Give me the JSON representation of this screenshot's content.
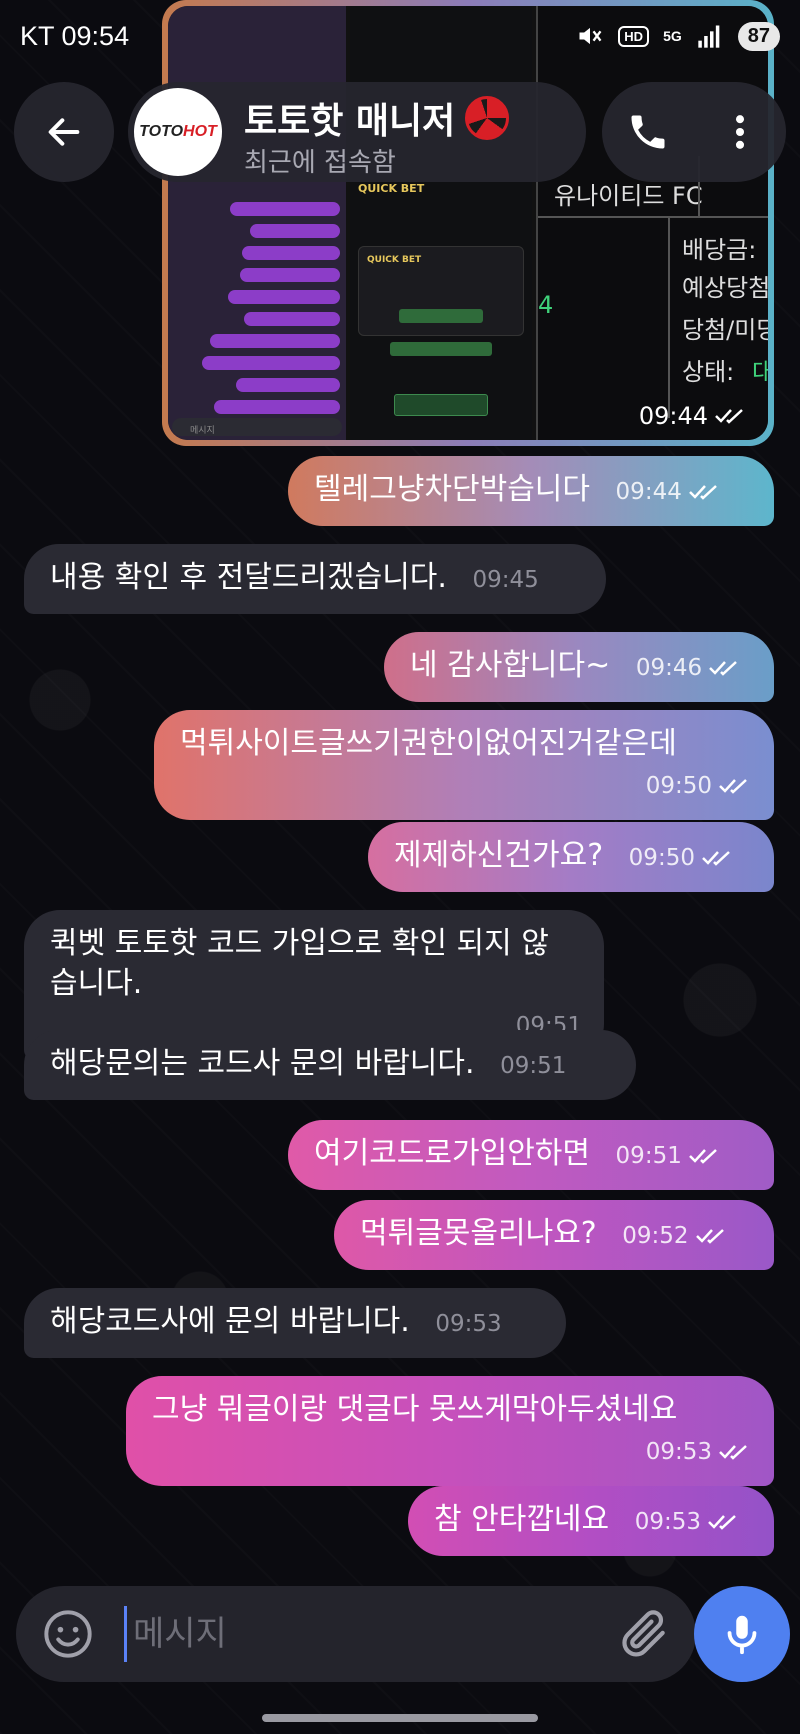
{
  "status_bar": {
    "left": "KT 09:54",
    "right_5g": "5G",
    "right_hd": "HD",
    "battery": "87"
  },
  "header": {
    "title": "토토핫 매니저",
    "status": "최근에 접속함",
    "avatar_text_a": "TOTO",
    "avatar_text_b": "HOT",
    "icons": [
      "back-arrow-icon",
      "phone-icon",
      "more-vertical-icon"
    ]
  },
  "image_message": {
    "time": "09:44",
    "screenshot_texts": {
      "title_partial": "유나이티드 FC",
      "rows": [
        "배당금:",
        "예상당첨금",
        "당첨/미당",
        "상태:"
      ],
      "status_value": "대",
      "left_digit": "4",
      "input_placeholder": "메시지"
    }
  },
  "messages": [
    {
      "dir": "out",
      "text": "텔레그냥차단박습니다",
      "time": "09:44",
      "read": true
    },
    {
      "dir": "in",
      "text": "내용 확인 후 전달드리겠습니다.",
      "time": "09:45"
    },
    {
      "dir": "out",
      "text": "네 감사합니다~",
      "time": "09:46",
      "read": true
    },
    {
      "dir": "out",
      "text": "먹튀사이트글쓰기권한이없어진거같은데",
      "time": "09:50",
      "read": true
    },
    {
      "dir": "out",
      "text": "제제하신건가요?",
      "time": "09:50",
      "read": true
    },
    {
      "dir": "in",
      "text": "퀵벳 토토핫 코드 가입으로 확인 되지 않습니다.",
      "time": "09:51"
    },
    {
      "dir": "in",
      "text": "해당문의는 코드사 문의 바랍니다.",
      "time": "09:51"
    },
    {
      "dir": "out",
      "text": "여기코드로가입안하면",
      "time": "09:51",
      "read": true
    },
    {
      "dir": "out",
      "text": "먹튀글못올리나요?",
      "time": "09:52",
      "read": true
    },
    {
      "dir": "in",
      "text": "해당코드사에 문의 바랍니다.",
      "time": "09:53"
    },
    {
      "dir": "out",
      "text": "그냥 뭐글이랑 댓글다 못쓰게막아두셨네요",
      "time": "09:53",
      "read": true
    },
    {
      "dir": "out",
      "text": "참 안타깝네요",
      "time": "09:53",
      "read": true
    }
  ],
  "input": {
    "placeholder": "메시지",
    "value": ""
  },
  "colors": {
    "accent": "#4f80f0",
    "incoming_bubble": "#2a2a33",
    "gradient_start": "#e2735e",
    "gradient_mid": "#b56cc0",
    "gradient_end": "#6fb8cc"
  }
}
